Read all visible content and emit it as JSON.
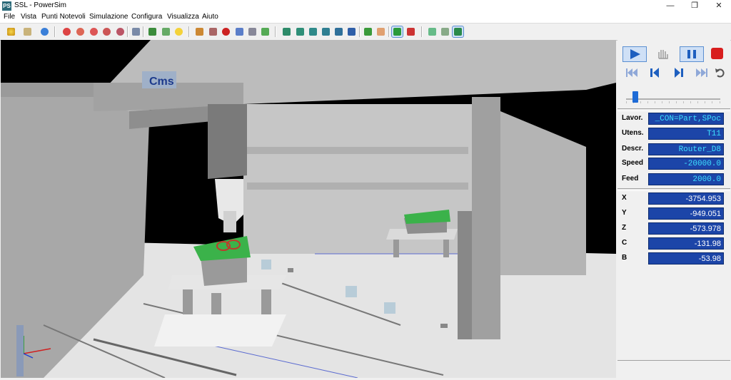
{
  "window": {
    "title": "SSL - PowerSim",
    "app_icon": "PS"
  },
  "menu": [
    "File",
    "Vista",
    "Punti Notevoli",
    "Simulazione",
    "Configura",
    "Visualizza",
    "Aiuto"
  ],
  "toolbar_icons": [
    "refresh-icon",
    "print-icon",
    "download-icon",
    "zoom-icon",
    "zoom-in-icon",
    "zoom-out-icon",
    "zoom-window-icon",
    "zoom-fit-icon",
    "fit-screen-icon",
    "machine-icon",
    "tool-icon",
    "lamp-icon",
    "pen-icon",
    "axis-icon",
    "record-icon",
    "report-icon",
    "table-icon",
    "graph-icon",
    "view-front-icon",
    "view-back-icon",
    "view-left-icon",
    "view-right-icon",
    "view-top-icon",
    "view-iso-icon",
    "pan-icon",
    "hand-icon",
    "check-icon",
    "marker-icon",
    "shield-icon",
    "shield-outline-icon",
    "shield-green-icon"
  ],
  "scene": {
    "brand": "Cms"
  },
  "controls": {
    "play": "play-icon",
    "hand": "hand-icon",
    "pause": "pause-icon",
    "stop": "stop-icon",
    "nav": [
      "skip-start-icon",
      "step-back-icon",
      "step-forward-icon",
      "skip-end-icon",
      "repeat-icon"
    ],
    "slider_value": 0.1
  },
  "info": [
    {
      "label": "Lavor.",
      "value": "_CON=Part,SPoc"
    },
    {
      "label": "Utens.",
      "value": "T11"
    },
    {
      "label": "Descr.",
      "value": "Router_D8"
    },
    {
      "label": "Speed",
      "value": "-20000.0"
    },
    {
      "label": "Feed",
      "value": "2000.0"
    }
  ],
  "coords": [
    {
      "label": "X",
      "value": "-3754.953"
    },
    {
      "label": "Y",
      "value": "-949.051"
    },
    {
      "label": "Z",
      "value": "-573.978"
    },
    {
      "label": "C",
      "value": "-131.98"
    },
    {
      "label": "B",
      "value": "-53.98"
    }
  ]
}
